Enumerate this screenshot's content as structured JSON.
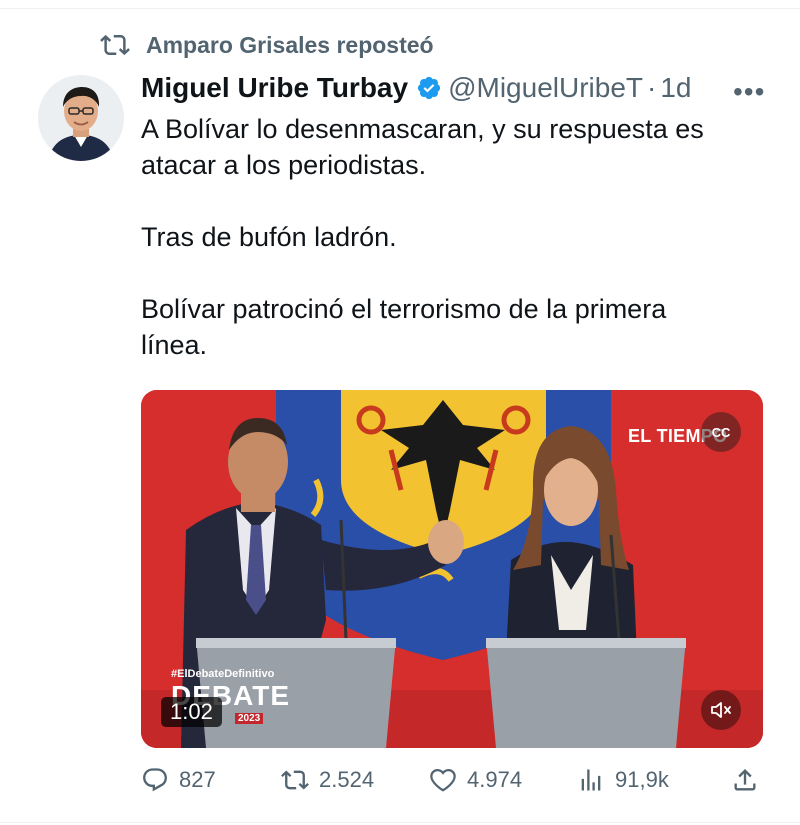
{
  "repost": {
    "label": "Amparo Grisales reposteó",
    "icon": "repost-icon"
  },
  "tweet": {
    "author_name": "Miguel Uribe Turbay",
    "handle": "@MiguelUribeT",
    "separator": "·",
    "time": "1d",
    "verified_color": "#1d9bf0",
    "paragraphs": [
      "A Bolívar lo desenmascaran, y su respuesta es\natacar a los periodistas.",
      "Tras de bufón ladrón.",
      "Bolívar patrocinó el terrorismo de la primera\nlínea."
    ]
  },
  "video": {
    "brand": "EL TIEMPO",
    "hashtag": "#ElDebateDefinitivo",
    "overlay_title": "DEBATE",
    "overlay_year": "2023",
    "duration": "1:02",
    "cc_label": "CC"
  },
  "actions": {
    "replies": "827",
    "reposts": "2.524",
    "likes": "4.974",
    "views": "91,9k"
  },
  "colors": {
    "text_secondary": "#536471",
    "accent": "#1d9bf0",
    "flag_red": "#d62d2d",
    "shield_blue": "#2a4fa8",
    "shield_gold": "#f2c230"
  }
}
